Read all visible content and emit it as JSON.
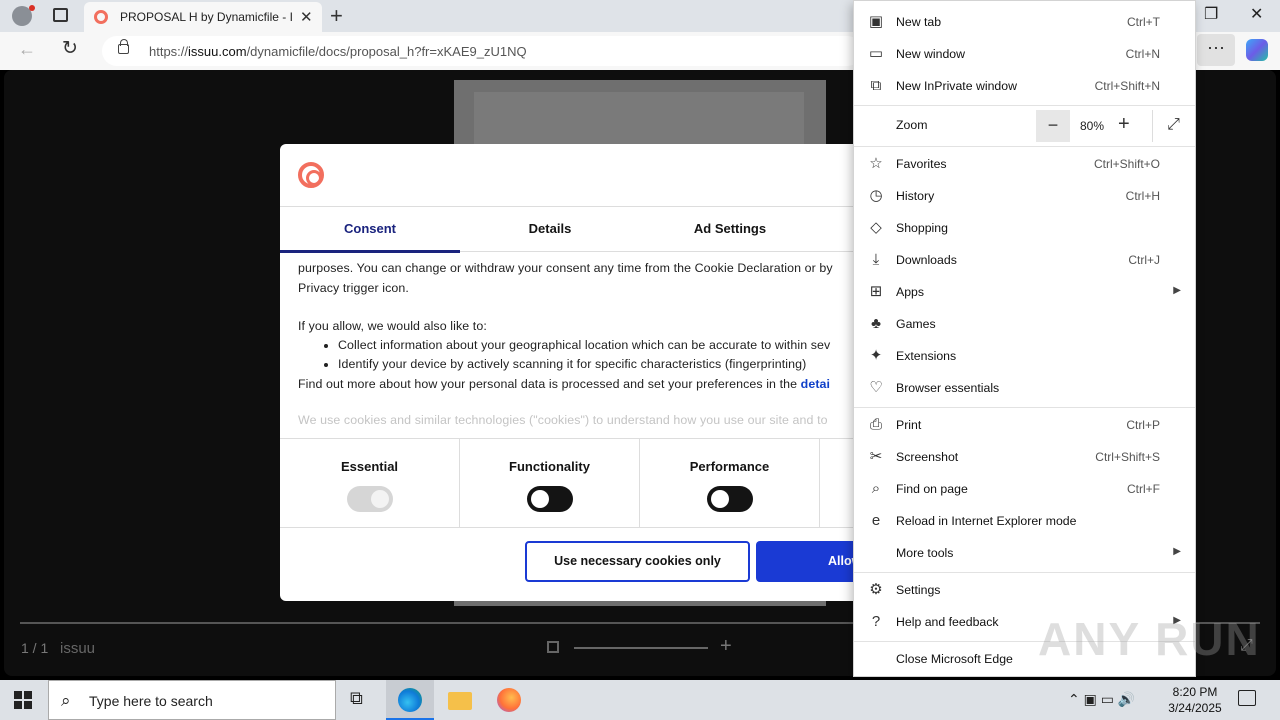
{
  "browser": {
    "tab_title": "PROPOSAL H by Dynamicfile - Issuu",
    "url_prefix": "https://",
    "url_domain": "issuu.com",
    "url_path": "/dynamicfile/docs/proposal_h?fr=xKAE9_zU1NQ"
  },
  "viewer": {
    "page_count": "1 / 1",
    "logo_text": "issuu"
  },
  "dialog": {
    "tabs": [
      "Consent",
      "Details",
      "Ad Settings"
    ],
    "body": {
      "line1": "purposes. You can change or withdraw your consent any time from the Cookie Declaration or by",
      "line2": "Privacy trigger icon.",
      "line3": "If you allow, we would also like to:",
      "bullet1": "Collect information about your geographical location which can be accurate to within sev",
      "bullet2": "Identify your device by actively scanning it for specific characteristics (fingerprinting)",
      "line4": "Find out more about how your personal data is processed and set your preferences in the ",
      "line4_link": "detai",
      "line5": "We use cookies and similar technologies (\"cookies\") to understand how you use our site and to"
    },
    "toggles": [
      {
        "label": "Essential",
        "state": "on-disabled"
      },
      {
        "label": "Functionality",
        "state": "off"
      },
      {
        "label": "Performance",
        "state": "off"
      }
    ],
    "btn_necessary": "Use necessary cookies only",
    "btn_allow": "Allow"
  },
  "menu": {
    "items": [
      {
        "icon": "new-tab-icon",
        "label": "New tab",
        "shortcut": "Ctrl+T"
      },
      {
        "icon": "new-window-icon",
        "label": "New window",
        "shortcut": "Ctrl+N"
      },
      {
        "icon": "inprivate-icon",
        "label": "New InPrivate window",
        "shortcut": "Ctrl+Shift+N"
      },
      {
        "label": "Zoom"
      },
      {
        "icon": "favorites-icon",
        "label": "Favorites",
        "shortcut": "Ctrl+Shift+O"
      },
      {
        "icon": "history-icon",
        "label": "History",
        "shortcut": "Ctrl+H"
      },
      {
        "icon": "shopping-icon",
        "label": "Shopping",
        "shortcut": ""
      },
      {
        "icon": "downloads-icon",
        "label": "Downloads",
        "shortcut": "Ctrl+J"
      },
      {
        "icon": "apps-icon",
        "label": "Apps",
        "shortcut": ""
      },
      {
        "icon": "games-icon",
        "label": "Games",
        "shortcut": ""
      },
      {
        "icon": "extensions-icon",
        "label": "Extensions",
        "shortcut": ""
      },
      {
        "icon": "browser-essentials-icon",
        "label": "Browser essentials",
        "shortcut": ""
      },
      {
        "icon": "print-icon",
        "label": "Print",
        "shortcut": "Ctrl+P"
      },
      {
        "icon": "screenshot-icon",
        "label": "Screenshot",
        "shortcut": "Ctrl+Shift+S"
      },
      {
        "icon": "find-icon",
        "label": "Find on page",
        "shortcut": "Ctrl+F"
      },
      {
        "icon": "ie-mode-icon",
        "label": "Reload in Internet Explorer mode",
        "shortcut": ""
      },
      {
        "label": "More tools",
        "shortcut": ""
      },
      {
        "icon": "settings-icon",
        "label": "Settings",
        "shortcut": ""
      },
      {
        "icon": "help-icon",
        "label": "Help and feedback",
        "shortcut": ""
      },
      {
        "label": "Close Microsoft Edge",
        "shortcut": ""
      }
    ],
    "zoom_value": "80%"
  },
  "watermark": "ANY RUN",
  "taskbar": {
    "search_placeholder": "Type here to search",
    "time": "8:20 PM",
    "date": "3/24/2025"
  }
}
